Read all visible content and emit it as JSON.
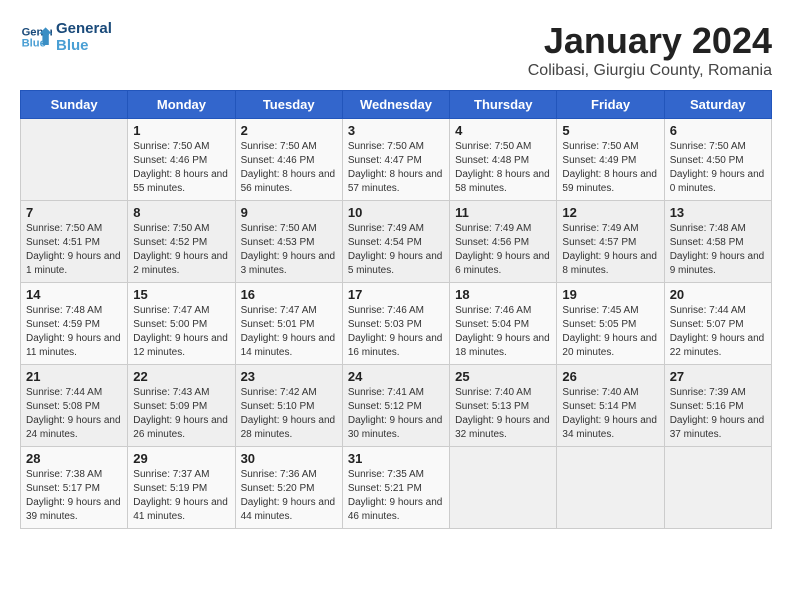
{
  "logo": {
    "line1": "General",
    "line2": "Blue"
  },
  "title": "January 2024",
  "subtitle": "Colibasi, Giurgiu County, Romania",
  "days_of_week": [
    "Sunday",
    "Monday",
    "Tuesday",
    "Wednesday",
    "Thursday",
    "Friday",
    "Saturday"
  ],
  "weeks": [
    [
      {
        "day": "",
        "sunrise": "",
        "sunset": "",
        "daylight": ""
      },
      {
        "day": "1",
        "sunrise": "Sunrise: 7:50 AM",
        "sunset": "Sunset: 4:46 PM",
        "daylight": "Daylight: 8 hours and 55 minutes."
      },
      {
        "day": "2",
        "sunrise": "Sunrise: 7:50 AM",
        "sunset": "Sunset: 4:46 PM",
        "daylight": "Daylight: 8 hours and 56 minutes."
      },
      {
        "day": "3",
        "sunrise": "Sunrise: 7:50 AM",
        "sunset": "Sunset: 4:47 PM",
        "daylight": "Daylight: 8 hours and 57 minutes."
      },
      {
        "day": "4",
        "sunrise": "Sunrise: 7:50 AM",
        "sunset": "Sunset: 4:48 PM",
        "daylight": "Daylight: 8 hours and 58 minutes."
      },
      {
        "day": "5",
        "sunrise": "Sunrise: 7:50 AM",
        "sunset": "Sunset: 4:49 PM",
        "daylight": "Daylight: 8 hours and 59 minutes."
      },
      {
        "day": "6",
        "sunrise": "Sunrise: 7:50 AM",
        "sunset": "Sunset: 4:50 PM",
        "daylight": "Daylight: 9 hours and 0 minutes."
      }
    ],
    [
      {
        "day": "7",
        "sunrise": "Sunrise: 7:50 AM",
        "sunset": "Sunset: 4:51 PM",
        "daylight": "Daylight: 9 hours and 1 minute."
      },
      {
        "day": "8",
        "sunrise": "Sunrise: 7:50 AM",
        "sunset": "Sunset: 4:52 PM",
        "daylight": "Daylight: 9 hours and 2 minutes."
      },
      {
        "day": "9",
        "sunrise": "Sunrise: 7:50 AM",
        "sunset": "Sunset: 4:53 PM",
        "daylight": "Daylight: 9 hours and 3 minutes."
      },
      {
        "day": "10",
        "sunrise": "Sunrise: 7:49 AM",
        "sunset": "Sunset: 4:54 PM",
        "daylight": "Daylight: 9 hours and 5 minutes."
      },
      {
        "day": "11",
        "sunrise": "Sunrise: 7:49 AM",
        "sunset": "Sunset: 4:56 PM",
        "daylight": "Daylight: 9 hours and 6 minutes."
      },
      {
        "day": "12",
        "sunrise": "Sunrise: 7:49 AM",
        "sunset": "Sunset: 4:57 PM",
        "daylight": "Daylight: 9 hours and 8 minutes."
      },
      {
        "day": "13",
        "sunrise": "Sunrise: 7:48 AM",
        "sunset": "Sunset: 4:58 PM",
        "daylight": "Daylight: 9 hours and 9 minutes."
      }
    ],
    [
      {
        "day": "14",
        "sunrise": "Sunrise: 7:48 AM",
        "sunset": "Sunset: 4:59 PM",
        "daylight": "Daylight: 9 hours and 11 minutes."
      },
      {
        "day": "15",
        "sunrise": "Sunrise: 7:47 AM",
        "sunset": "Sunset: 5:00 PM",
        "daylight": "Daylight: 9 hours and 12 minutes."
      },
      {
        "day": "16",
        "sunrise": "Sunrise: 7:47 AM",
        "sunset": "Sunset: 5:01 PM",
        "daylight": "Daylight: 9 hours and 14 minutes."
      },
      {
        "day": "17",
        "sunrise": "Sunrise: 7:46 AM",
        "sunset": "Sunset: 5:03 PM",
        "daylight": "Daylight: 9 hours and 16 minutes."
      },
      {
        "day": "18",
        "sunrise": "Sunrise: 7:46 AM",
        "sunset": "Sunset: 5:04 PM",
        "daylight": "Daylight: 9 hours and 18 minutes."
      },
      {
        "day": "19",
        "sunrise": "Sunrise: 7:45 AM",
        "sunset": "Sunset: 5:05 PM",
        "daylight": "Daylight: 9 hours and 20 minutes."
      },
      {
        "day": "20",
        "sunrise": "Sunrise: 7:44 AM",
        "sunset": "Sunset: 5:07 PM",
        "daylight": "Daylight: 9 hours and 22 minutes."
      }
    ],
    [
      {
        "day": "21",
        "sunrise": "Sunrise: 7:44 AM",
        "sunset": "Sunset: 5:08 PM",
        "daylight": "Daylight: 9 hours and 24 minutes."
      },
      {
        "day": "22",
        "sunrise": "Sunrise: 7:43 AM",
        "sunset": "Sunset: 5:09 PM",
        "daylight": "Daylight: 9 hours and 26 minutes."
      },
      {
        "day": "23",
        "sunrise": "Sunrise: 7:42 AM",
        "sunset": "Sunset: 5:10 PM",
        "daylight": "Daylight: 9 hours and 28 minutes."
      },
      {
        "day": "24",
        "sunrise": "Sunrise: 7:41 AM",
        "sunset": "Sunset: 5:12 PM",
        "daylight": "Daylight: 9 hours and 30 minutes."
      },
      {
        "day": "25",
        "sunrise": "Sunrise: 7:40 AM",
        "sunset": "Sunset: 5:13 PM",
        "daylight": "Daylight: 9 hours and 32 minutes."
      },
      {
        "day": "26",
        "sunrise": "Sunrise: 7:40 AM",
        "sunset": "Sunset: 5:14 PM",
        "daylight": "Daylight: 9 hours and 34 minutes."
      },
      {
        "day": "27",
        "sunrise": "Sunrise: 7:39 AM",
        "sunset": "Sunset: 5:16 PM",
        "daylight": "Daylight: 9 hours and 37 minutes."
      }
    ],
    [
      {
        "day": "28",
        "sunrise": "Sunrise: 7:38 AM",
        "sunset": "Sunset: 5:17 PM",
        "daylight": "Daylight: 9 hours and 39 minutes."
      },
      {
        "day": "29",
        "sunrise": "Sunrise: 7:37 AM",
        "sunset": "Sunset: 5:19 PM",
        "daylight": "Daylight: 9 hours and 41 minutes."
      },
      {
        "day": "30",
        "sunrise": "Sunrise: 7:36 AM",
        "sunset": "Sunset: 5:20 PM",
        "daylight": "Daylight: 9 hours and 44 minutes."
      },
      {
        "day": "31",
        "sunrise": "Sunrise: 7:35 AM",
        "sunset": "Sunset: 5:21 PM",
        "daylight": "Daylight: 9 hours and 46 minutes."
      },
      {
        "day": "",
        "sunrise": "",
        "sunset": "",
        "daylight": ""
      },
      {
        "day": "",
        "sunrise": "",
        "sunset": "",
        "daylight": ""
      },
      {
        "day": "",
        "sunrise": "",
        "sunset": "",
        "daylight": ""
      }
    ]
  ]
}
